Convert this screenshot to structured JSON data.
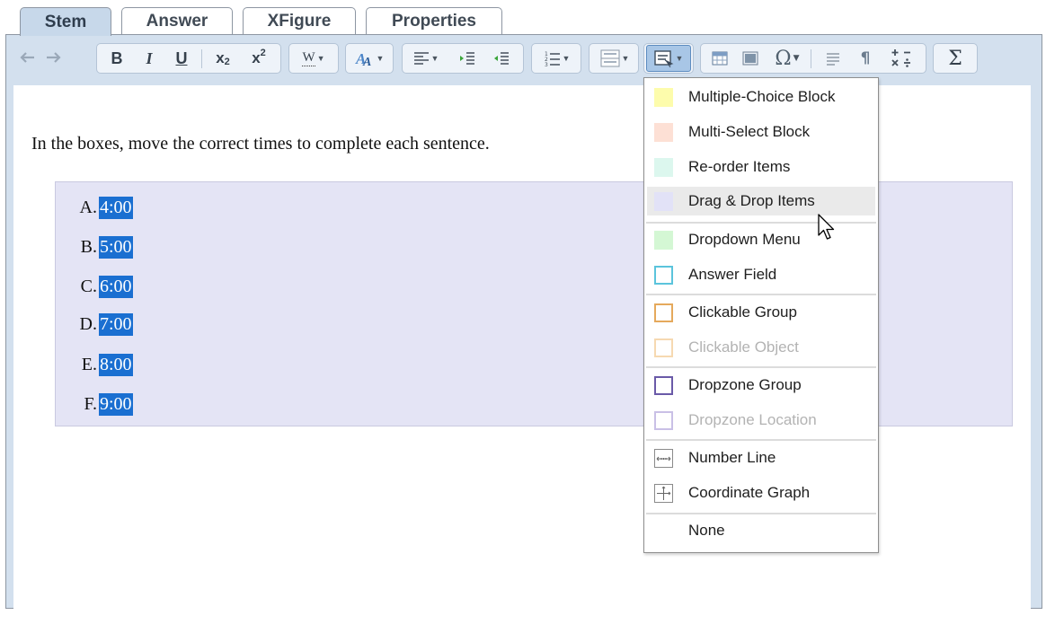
{
  "tabs": [
    {
      "label": "Stem",
      "active": true
    },
    {
      "label": "Answer",
      "active": false
    },
    {
      "label": "XFigure",
      "active": false
    },
    {
      "label": "Properties",
      "active": false
    }
  ],
  "toolbar": {
    "buttons": {
      "undo": "undo-icon",
      "redo": "redo-icon",
      "bold": "B",
      "italic": "I",
      "underline": "U",
      "subscript": "x",
      "subscript_mark": "2",
      "superscript": "x",
      "superscript_mark": "2",
      "font_style": "W",
      "sigma": "Σ",
      "omega": "Ω"
    }
  },
  "content": {
    "instruction": "In the boxes, move the correct times to complete each sentence.",
    "options": [
      {
        "letter": "A.",
        "value": "4:00"
      },
      {
        "letter": "B.",
        "value": "5:00"
      },
      {
        "letter": "C.",
        "value": "6:00"
      },
      {
        "letter": "D.",
        "value": "7:00"
      },
      {
        "letter": "E.",
        "value": "8:00"
      },
      {
        "letter": "F.",
        "value": "9:00"
      }
    ]
  },
  "menu": {
    "items": [
      {
        "label": "Multiple-Choice Block",
        "color": "#fdfcac",
        "swatch": "fill",
        "disabled": false
      },
      {
        "label": "Multi-Select Block",
        "color": "#fde0d5",
        "swatch": "fill",
        "disabled": false
      },
      {
        "label": "Re-order Items",
        "color": "#dcf7ee",
        "swatch": "fill",
        "disabled": false
      },
      {
        "label": "Drag & Drop Items",
        "color": "#e2e2f7",
        "swatch": "fill",
        "disabled": false,
        "hovered": true
      },
      {
        "label": "Dropdown Menu",
        "color": "#d4f7d4",
        "swatch": "fill",
        "disabled": false
      },
      {
        "label": "Answer Field",
        "color": "#5bc4dc",
        "swatch": "outline",
        "disabled": false
      },
      {
        "label": "Clickable Group",
        "color": "#e5a95c",
        "swatch": "outline",
        "disabled": false
      },
      {
        "label": "Clickable Object",
        "color": "#f6d9b1",
        "swatch": "outline",
        "disabled": true
      },
      {
        "label": "Dropzone Group",
        "color": "#6a5aa8",
        "swatch": "outline",
        "disabled": false
      },
      {
        "label": "Dropzone Location",
        "color": "#c9c0e6",
        "swatch": "outline",
        "disabled": true
      },
      {
        "label": "Number Line",
        "icon": "number-line-icon",
        "disabled": false
      },
      {
        "label": "Coordinate Graph",
        "icon": "coordinate-graph-icon",
        "disabled": false
      },
      {
        "label": "None",
        "disabled": false
      }
    ]
  }
}
